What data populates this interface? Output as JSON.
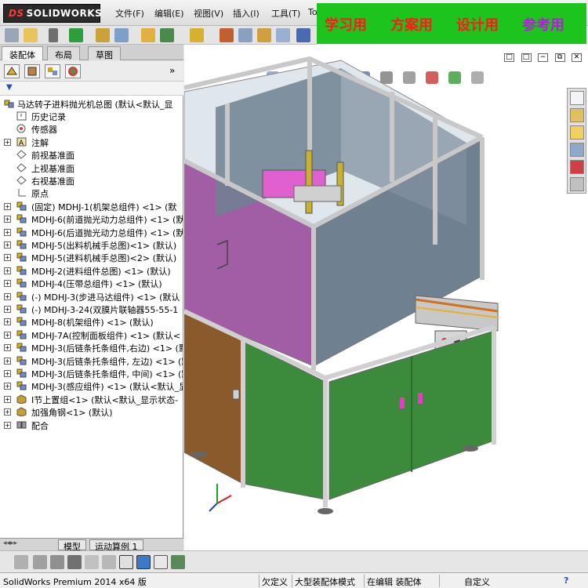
{
  "app": {
    "logo_text": "SOLIDWORKS",
    "logo_prefix": "DS"
  },
  "menu": [
    "文件(F)",
    "编辑(E)",
    "视图(V)",
    "插入(I)",
    "工具(T)",
    "To"
  ],
  "banner": {
    "words": [
      "学习用",
      "方案用",
      "设计用",
      "参考用"
    ],
    "colors": {
      "background": "#1ec41e",
      "text": "#ff1a1a",
      "last_text": "#b41ed8"
    }
  },
  "panel": {
    "tabs": [
      "装配体",
      "布局",
      "草图"
    ],
    "active_tab": "装配体",
    "more_glyph": "»",
    "filter_glyph": "▼"
  },
  "tree": {
    "root": "马达转子进料抛光机总图  (默认<默认_显",
    "items": [
      {
        "label": "历史记录",
        "icon": "history-icon",
        "expand": ""
      },
      {
        "label": "传感器",
        "icon": "sensor-icon",
        "expand": ""
      },
      {
        "label": "注解",
        "icon": "annotation-icon",
        "expand": "+"
      },
      {
        "label": "前视基准面",
        "icon": "plane-icon",
        "expand": ""
      },
      {
        "label": "上视基准面",
        "icon": "plane-icon",
        "expand": ""
      },
      {
        "label": "右视基准面",
        "icon": "plane-icon",
        "expand": ""
      },
      {
        "label": "原点",
        "icon": "origin-icon",
        "expand": ""
      },
      {
        "label": "(固定) MDHJ-1(机架总组件) <1> (默",
        "icon": "assembly-icon",
        "expand": "+"
      },
      {
        "label": "MDHJ-6(前道抛光动力总组件) <1> (默",
        "icon": "assembly-icon",
        "expand": "+"
      },
      {
        "label": "MDHJ-6(后道抛光动力总组件) <1> (默",
        "icon": "assembly-icon",
        "expand": "+"
      },
      {
        "label": "MDHJ-5(出料机械手总图)<1> (默认)",
        "icon": "assembly-icon",
        "expand": "+"
      },
      {
        "label": "MDHJ-5(进料机械手总图)<2> (默认)",
        "icon": "assembly-icon",
        "expand": "+"
      },
      {
        "label": "MDHJ-2(进料组件总图) <1> (默认)",
        "icon": "assembly-icon",
        "expand": "+"
      },
      {
        "label": "MDHJ-4(压带总组件) <1> (默认)",
        "icon": "assembly-icon",
        "expand": "+"
      },
      {
        "label": "(-) MDHJ-3(步进马达组件) <1> (默认",
        "icon": "assembly-icon",
        "expand": "+"
      },
      {
        "label": "(-) MDHJ-3-24(双膜片联轴器55-55-1",
        "icon": "assembly-icon",
        "expand": "+"
      },
      {
        "label": "MDHJ-8(机架组件) <1> (默认)",
        "icon": "assembly-icon",
        "expand": "+"
      },
      {
        "label": "MDHJ-7A(控制面板组件) <1> (默认<",
        "icon": "assembly-icon",
        "expand": "+"
      },
      {
        "label": "MDHJ-3(后链条托条组件,右边) <1> (默",
        "icon": "assembly-icon",
        "expand": "+"
      },
      {
        "label": "MDHJ-3(后链条托条组件, 左边) <1> (默",
        "icon": "assembly-icon",
        "expand": "+"
      },
      {
        "label": "MDHJ-3(后链条托条组件, 中间) <1> (默",
        "icon": "assembly-icon",
        "expand": "+"
      },
      {
        "label": "MDHJ-3(感应组件) <1> (默认<默认_显",
        "icon": "assembly-icon",
        "expand": "+"
      },
      {
        "label": "I节上置组<1> (默认<默认_显示状态-",
        "icon": "part-icon",
        "expand": "+"
      },
      {
        "label": "加强角钢<1> (默认)",
        "icon": "part-icon",
        "expand": "+"
      },
      {
        "label": "配合",
        "icon": "mates-icon",
        "expand": "+"
      }
    ]
  },
  "bottom_tabs": [
    "模型",
    "运动算例 1"
  ],
  "status": {
    "app_version": "SolidWorks Premium 2014 x64 版",
    "custom": "欠定义",
    "mode": "大型装配体模式",
    "editing": "在编辑 装配体",
    "units": "自定义",
    "help_glyph": "?"
  },
  "viewport": {
    "hud_icons": [
      "zoom-fit-icon",
      "zoom-area-icon",
      "previous-view-icon",
      "section-view-icon",
      "view-orientation-icon",
      "display-style-icon",
      "hide-show-icon",
      "appearance-icon",
      "scene-icon",
      "view-settings-icon"
    ],
    "window_controls": [
      "□",
      "□",
      "−",
      "⧉",
      "✕"
    ],
    "collapse_glyph": "◂"
  },
  "colors": {
    "panel_purple": "#a25ea4",
    "panel_glass": "#6f8190",
    "panel_green": "#3c8a3c",
    "panel_brown": "#8b5a2b",
    "frame": "#d8d8d8",
    "accent_red": "#ff1a1a"
  }
}
